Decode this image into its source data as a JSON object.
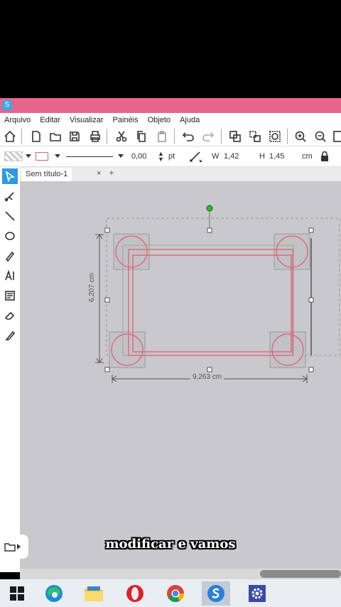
{
  "app": {
    "icon": "sketch-app-icon"
  },
  "menu": {
    "items": [
      "Arquivo",
      "Editar",
      "Visualizar",
      "Painéis",
      "Objeto",
      "Ajuda"
    ]
  },
  "props": {
    "stroke_value": "0,00",
    "stroke_unit": "pt",
    "w_label": "W",
    "w_value": "1,42",
    "h_label": "H",
    "h_value": "1,45",
    "unit": "cm"
  },
  "tabs": {
    "title": "Sem título-1",
    "close": "×",
    "add": "+"
  },
  "canvas": {
    "height_label": "6,207 cm",
    "width_label": "9,263 cm"
  },
  "caption": "modificar e vamos",
  "colors": {
    "accent": "#e7668c",
    "selected_tool": "#2d9ae0",
    "shape_stroke": "#e06070"
  },
  "taskbar": {
    "apps": [
      "windows-start",
      "edge",
      "file-explorer",
      "opera",
      "chrome",
      "sketch-app",
      "settings"
    ]
  }
}
